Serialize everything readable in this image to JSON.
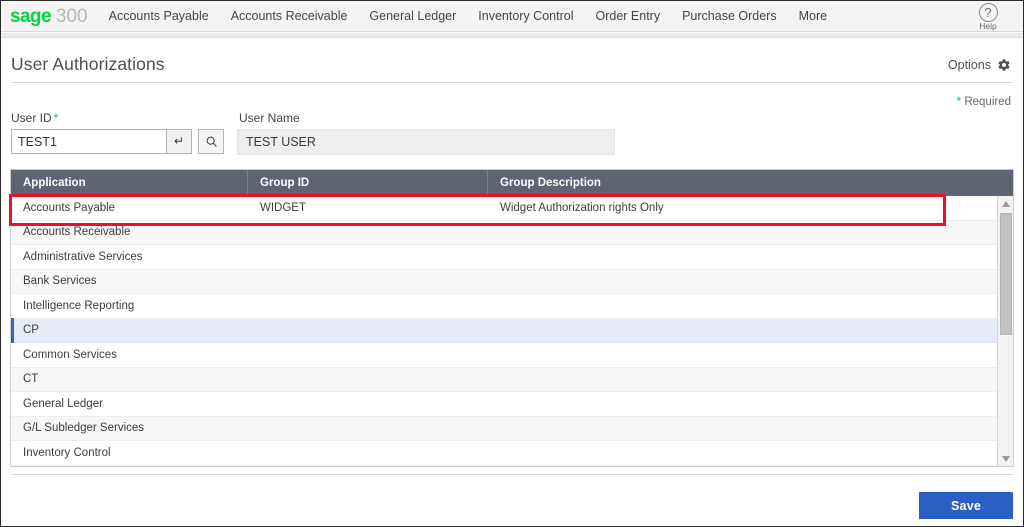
{
  "brand": {
    "name": "sage",
    "product": "300",
    "color": "#00d43f"
  },
  "topnav": {
    "items": [
      {
        "label": "Accounts Payable"
      },
      {
        "label": "Accounts Receivable"
      },
      {
        "label": "General Ledger"
      },
      {
        "label": "Inventory Control"
      },
      {
        "label": "Order Entry"
      },
      {
        "label": "Purchase Orders"
      },
      {
        "label": "More"
      }
    ],
    "help": {
      "glyph": "?",
      "label": "Help"
    }
  },
  "header": {
    "title": "User Authorizations",
    "options_label": "Options",
    "required_star": "*",
    "required_label": "Required"
  },
  "form": {
    "user_id": {
      "label": "User ID",
      "required_marker": "*",
      "value": "TEST1",
      "placeholder": "",
      "enter_glyph": "↵"
    },
    "user_name": {
      "label": "User Name",
      "value": "TEST USER",
      "placeholder": ""
    }
  },
  "grid": {
    "columns": [
      "Application",
      "Group ID",
      "Group Description"
    ],
    "rows": [
      {
        "application": "Accounts Payable",
        "group_id": "WIDGET",
        "group_description": "Widget Authorization rights Only"
      },
      {
        "application": "Accounts Receivable",
        "group_id": "",
        "group_description": ""
      },
      {
        "application": "Administrative Services",
        "group_id": "",
        "group_description": ""
      },
      {
        "application": "Bank Services",
        "group_id": "",
        "group_description": ""
      },
      {
        "application": "Intelligence Reporting",
        "group_id": "",
        "group_description": ""
      },
      {
        "application": "CP",
        "group_id": "",
        "group_description": ""
      },
      {
        "application": "Common Services",
        "group_id": "",
        "group_description": ""
      },
      {
        "application": "CT",
        "group_id": "",
        "group_description": ""
      },
      {
        "application": "General Ledger",
        "group_id": "",
        "group_description": ""
      },
      {
        "application": "G/L Subledger Services",
        "group_id": "",
        "group_description": ""
      },
      {
        "application": "Inventory Control",
        "group_id": "",
        "group_description": ""
      }
    ],
    "selected_row_index": 5,
    "highlight_row_index": 0,
    "highlight_color": "#e8102a"
  },
  "footer": {
    "save_label": "Save",
    "save_color": "#2b5fc4"
  }
}
